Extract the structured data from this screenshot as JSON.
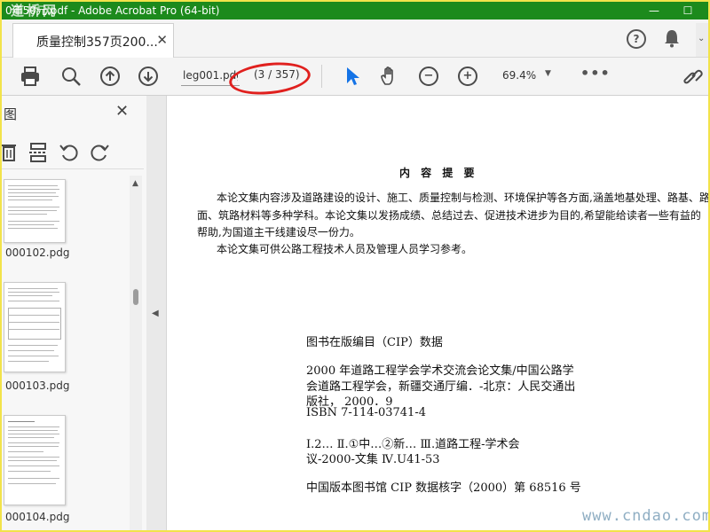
{
  "window": {
    "title": "0年50元.pdf - Adobe Acrobat Pro (64-bit)",
    "watermark": "道桥网",
    "minimize_glyph": "—",
    "maximize_glyph": "☐"
  },
  "tab": {
    "label": "质量控制357页200...",
    "close_glyph": "✕"
  },
  "header_icons": [
    "help-icon",
    "bell-icon"
  ],
  "toolbar": {
    "page_input_value": "leg001.pdg",
    "page_count": "(3 / 357)",
    "zoom": "69.4%",
    "zoom_caret": "▼",
    "more": "•••",
    "zoom_out_glyph": "−",
    "zoom_in_glyph": "+",
    "icons": [
      "print-icon",
      "search-icon",
      "prev-page-icon",
      "next-page-icon",
      "select-cursor-icon",
      "hand-icon",
      "zoom-out-icon",
      "zoom-in-icon",
      "link-icon"
    ]
  },
  "sidepanel": {
    "title": "图",
    "close_glyph": "✕",
    "tools": [
      "delete-icon",
      "insert-icon",
      "rotate-left-icon",
      "rotate-right-icon"
    ],
    "thumbnails": [
      {
        "label": "000102.pdg"
      },
      {
        "label": "000103.pdg"
      },
      {
        "label": "000104.pdg"
      }
    ],
    "scroll_up_glyph": "▲",
    "collapse_glyph": "◀"
  },
  "document": {
    "summary_title": "内 容 提 要",
    "summary_lines": [
      "本论文集内容涉及道路建设的设计、施工、质量控制与检测、环境保护等各方面,涵盖地基处理、路基、路",
      "面、筑路材料等多种学科。本论文集以发扬成绩、总结过去、促进技术进步为目的,希望能给读者一些有益的",
      "帮助,为国道主干线建设尽一份力。",
      "本论文集可供公路工程技术人员及管理人员学习参考。"
    ],
    "cip_title": "图书在版编目（CIP）数据",
    "cip_lines": [
      "2000 年道路工程学会学术交流会论文集/中国公路学",
      "会道路工程学会，新疆交通厅编．-北京：人民交通出",
      "版社，  2000．9",
      "ISBN 7-114-03741-4",
      "Ⅰ.2…   Ⅱ.①中…②新…  Ⅲ.道路工程-学术会",
      "议-2000-文集  Ⅳ.U41-53",
      "中国版本图书馆 CIP 数据核字（2000）第 68516 号"
    ]
  },
  "site_watermark": "www.cndao.com",
  "colors": {
    "titlebar": "#1c8a1c",
    "frame": "#f2e34a",
    "annotation_oval": "#e0201e",
    "cursor_icon": "#1473e6"
  }
}
